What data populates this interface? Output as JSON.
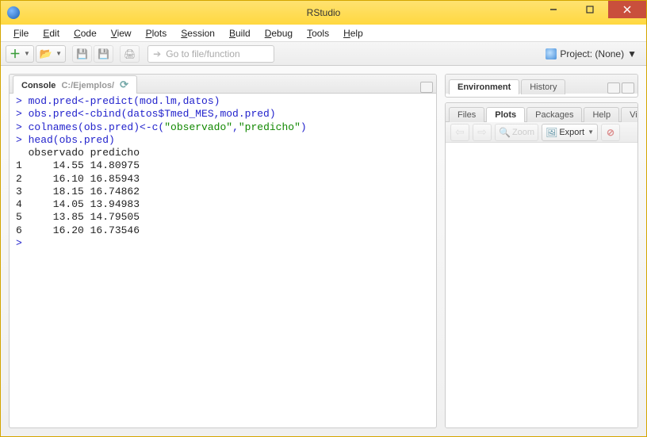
{
  "window": {
    "title": "RStudio"
  },
  "menu": {
    "file": "File",
    "edit": "Edit",
    "code": "Code",
    "view": "View",
    "plots": "Plots",
    "session": "Session",
    "build": "Build",
    "debug": "Debug",
    "tools": "Tools",
    "help": "Help"
  },
  "toolbar": {
    "gotofile_placeholder": "Go to file/function",
    "project_label": "Project: (None)"
  },
  "console": {
    "tab_label": "Console",
    "path": "C:/Ejemplos/",
    "lines": [
      {
        "t": "cmd",
        "text": "> mod.pred<-predict(mod.lm,datos)"
      },
      {
        "t": "cmd",
        "text": "> obs.pred<-cbind(datos$Tmed_MES,mod.pred)"
      },
      {
        "t": "cmdstr",
        "prefix": "> colnames(obs.pred)<-c(",
        "s1": "\"observado\"",
        "mid": ",",
        "s2": "\"predicho\"",
        "suffix": ")"
      },
      {
        "t": "cmd",
        "text": "> head(obs.pred)"
      },
      {
        "t": "out",
        "text": "  observado predicho"
      },
      {
        "t": "out",
        "text": "1     14.55 14.80975"
      },
      {
        "t": "out",
        "text": "2     16.10 16.85943"
      },
      {
        "t": "out",
        "text": "3     18.15 16.74862"
      },
      {
        "t": "out",
        "text": "4     14.05 13.94983"
      },
      {
        "t": "out",
        "text": "5     13.85 14.79505"
      },
      {
        "t": "out",
        "text": "6     16.20 16.73546"
      },
      {
        "t": "cmd",
        "text": "> "
      }
    ]
  },
  "right_top": {
    "tabs": {
      "env": "Environment",
      "hist": "History"
    }
  },
  "right_bottom": {
    "tabs": {
      "files": "Files",
      "plots": "Plots",
      "packages": "Packages",
      "help": "Help",
      "viewer": "Viewer"
    },
    "toolbar": {
      "zoom": "Zoom",
      "export": "Export"
    }
  }
}
